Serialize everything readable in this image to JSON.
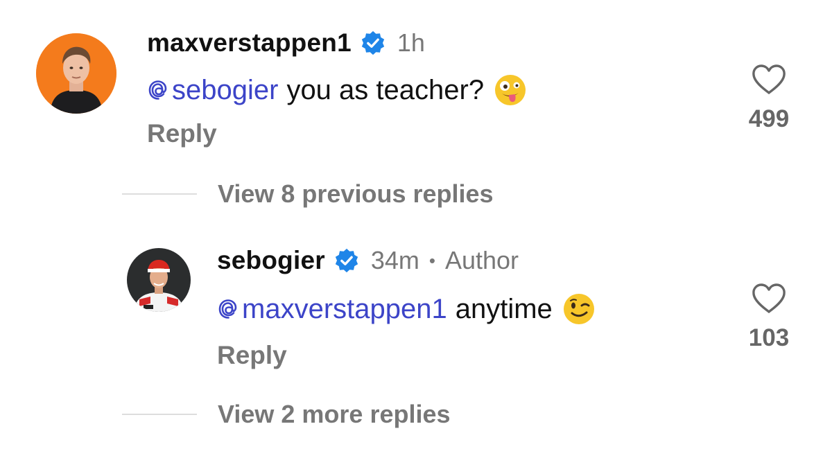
{
  "comment1": {
    "username": "maxverstappen1",
    "time": "1h",
    "mention": "sebogier",
    "text": "you as teacher?",
    "emoji": "zany-face",
    "reply_label": "Reply",
    "like_count": "499"
  },
  "view_previous": "View 8 previous replies",
  "comment2": {
    "username": "sebogier",
    "time": "34m",
    "separator": "•",
    "role": "Author",
    "mention": "maxverstappen1",
    "text": "anytime",
    "emoji": "winking-face",
    "reply_label": "Reply",
    "like_count": "103"
  },
  "view_more": "View 2 more replies",
  "colors": {
    "mention": "#3c44c8",
    "verified": "#1f85e8",
    "muted": "#777777"
  }
}
